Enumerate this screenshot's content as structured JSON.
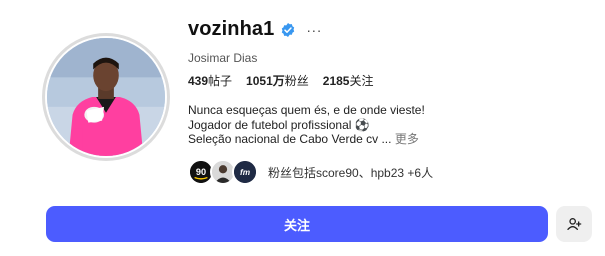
{
  "profile": {
    "username": "vozinha1",
    "verified_icon": "verified-badge-icon",
    "more_icon": "more-options-icon",
    "more_glyph": "···",
    "full_name": "Josimar Dias",
    "avatar_icon": "profile-photo"
  },
  "stats": {
    "posts_count": "439",
    "posts_label": "帖子",
    "followers_count": "1051万",
    "followers_label": "粉丝",
    "following_count": "2185",
    "following_label": "关注"
  },
  "bio": {
    "line1": "Nunca esqueças quem és, e de onde vieste!",
    "line2": "Jogador de futebol profissional ⚽",
    "line3": "Seleção nacional de Cabo Verde cv ...",
    "more_label": "更多"
  },
  "followed_by": {
    "avatars": [
      "score90-avatar",
      "hpb23-avatar",
      "third-account-avatar"
    ],
    "avatar1_text": "90",
    "avatar3_text": "fm",
    "text": "粉丝包括score90、hpb23 +6人"
  },
  "actions": {
    "follow_label": "关注",
    "suggest_icon": "add-person-icon"
  },
  "colors": {
    "accent": "#4c5cff",
    "verified": "#3897f0",
    "secondary_button_bg": "#efefef"
  }
}
